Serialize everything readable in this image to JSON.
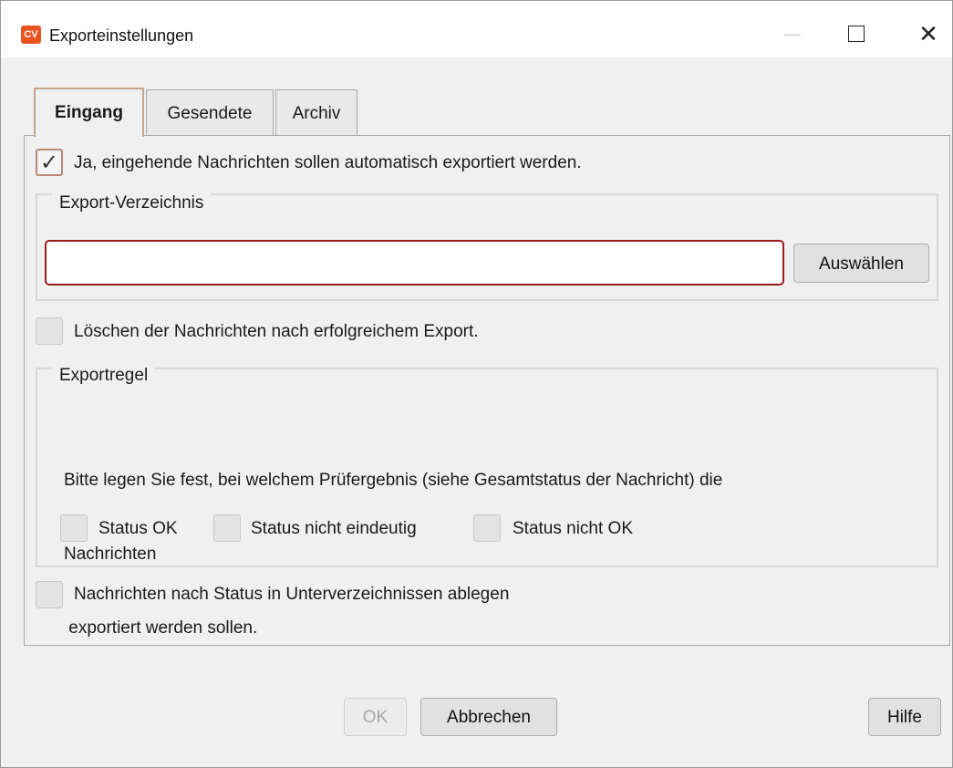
{
  "window": {
    "title": "Exporteinstellungen",
    "app_icon_text": "CV",
    "minimize_glyph": "—",
    "close_glyph": "✕"
  },
  "tabs": [
    {
      "label": "Eingang",
      "active": true
    },
    {
      "label": "Gesendete",
      "active": false
    },
    {
      "label": "Archiv",
      "active": false
    }
  ],
  "auto_export": {
    "label": "Ja, eingehende Nachrichten sollen automatisch exportiert werden.",
    "checked": true,
    "check_glyph": "✓"
  },
  "export_dir": {
    "group_title": "Export-Verzeichnis",
    "input_value": "",
    "choose_button": "Auswählen"
  },
  "delete_after": {
    "label": "Löschen der Nachrichten nach erfolgreichem Export.",
    "checked": false
  },
  "export_rule": {
    "group_title": "Exportregel",
    "description_line1": "Bitte legen Sie fest, bei welchem Prüfergebnis (siehe Gesamtstatus der Nachricht) die",
    "description_line2": "Nachrichten",
    "description_line3": " exportiert werden sollen.",
    "options": [
      {
        "label": "Status OK",
        "checked": false
      },
      {
        "label": "Status nicht eindeutig",
        "checked": false
      },
      {
        "label": "Status nicht OK",
        "checked": false
      }
    ]
  },
  "subfolders": {
    "label": "Nachrichten nach Status in Unterverzeichnissen ablegen",
    "checked": false
  },
  "footer": {
    "ok": "OK",
    "ok_enabled": false,
    "cancel": "Abbrechen",
    "help": "Hilfe"
  },
  "colors": {
    "accent_tab_border": "#c4a58a",
    "input_error_border": "#9e1b1b",
    "app_icon": "#e8531f"
  }
}
